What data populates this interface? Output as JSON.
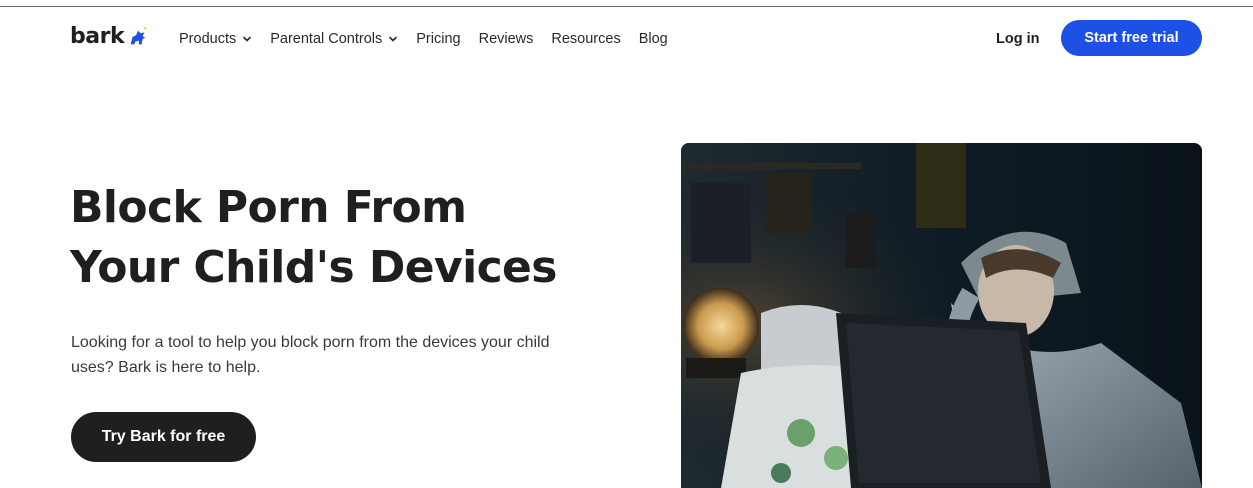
{
  "brand": {
    "name": "bark"
  },
  "nav": {
    "items": [
      {
        "label": "Products",
        "has_dropdown": true
      },
      {
        "label": "Parental Controls",
        "has_dropdown": true
      },
      {
        "label": "Pricing",
        "has_dropdown": false
      },
      {
        "label": "Reviews",
        "has_dropdown": false
      },
      {
        "label": "Resources",
        "has_dropdown": false
      },
      {
        "label": "Blog",
        "has_dropdown": false
      }
    ],
    "login_label": "Log in",
    "trial_label": "Start free trial"
  },
  "hero": {
    "title_line1": "Block Porn From",
    "title_line2": "Your Child's Devices",
    "description": "Looking for a tool to help you block porn from the devices your child uses? Bark is here to help.",
    "cta_label": "Try Bark for free"
  },
  "colors": {
    "primary_blue": "#1d51e6",
    "dark": "#1f1f1f",
    "white": "#ffffff"
  },
  "icons": {
    "logo": "bark-dog-logo",
    "dropdown": "chevron-down-icon"
  }
}
